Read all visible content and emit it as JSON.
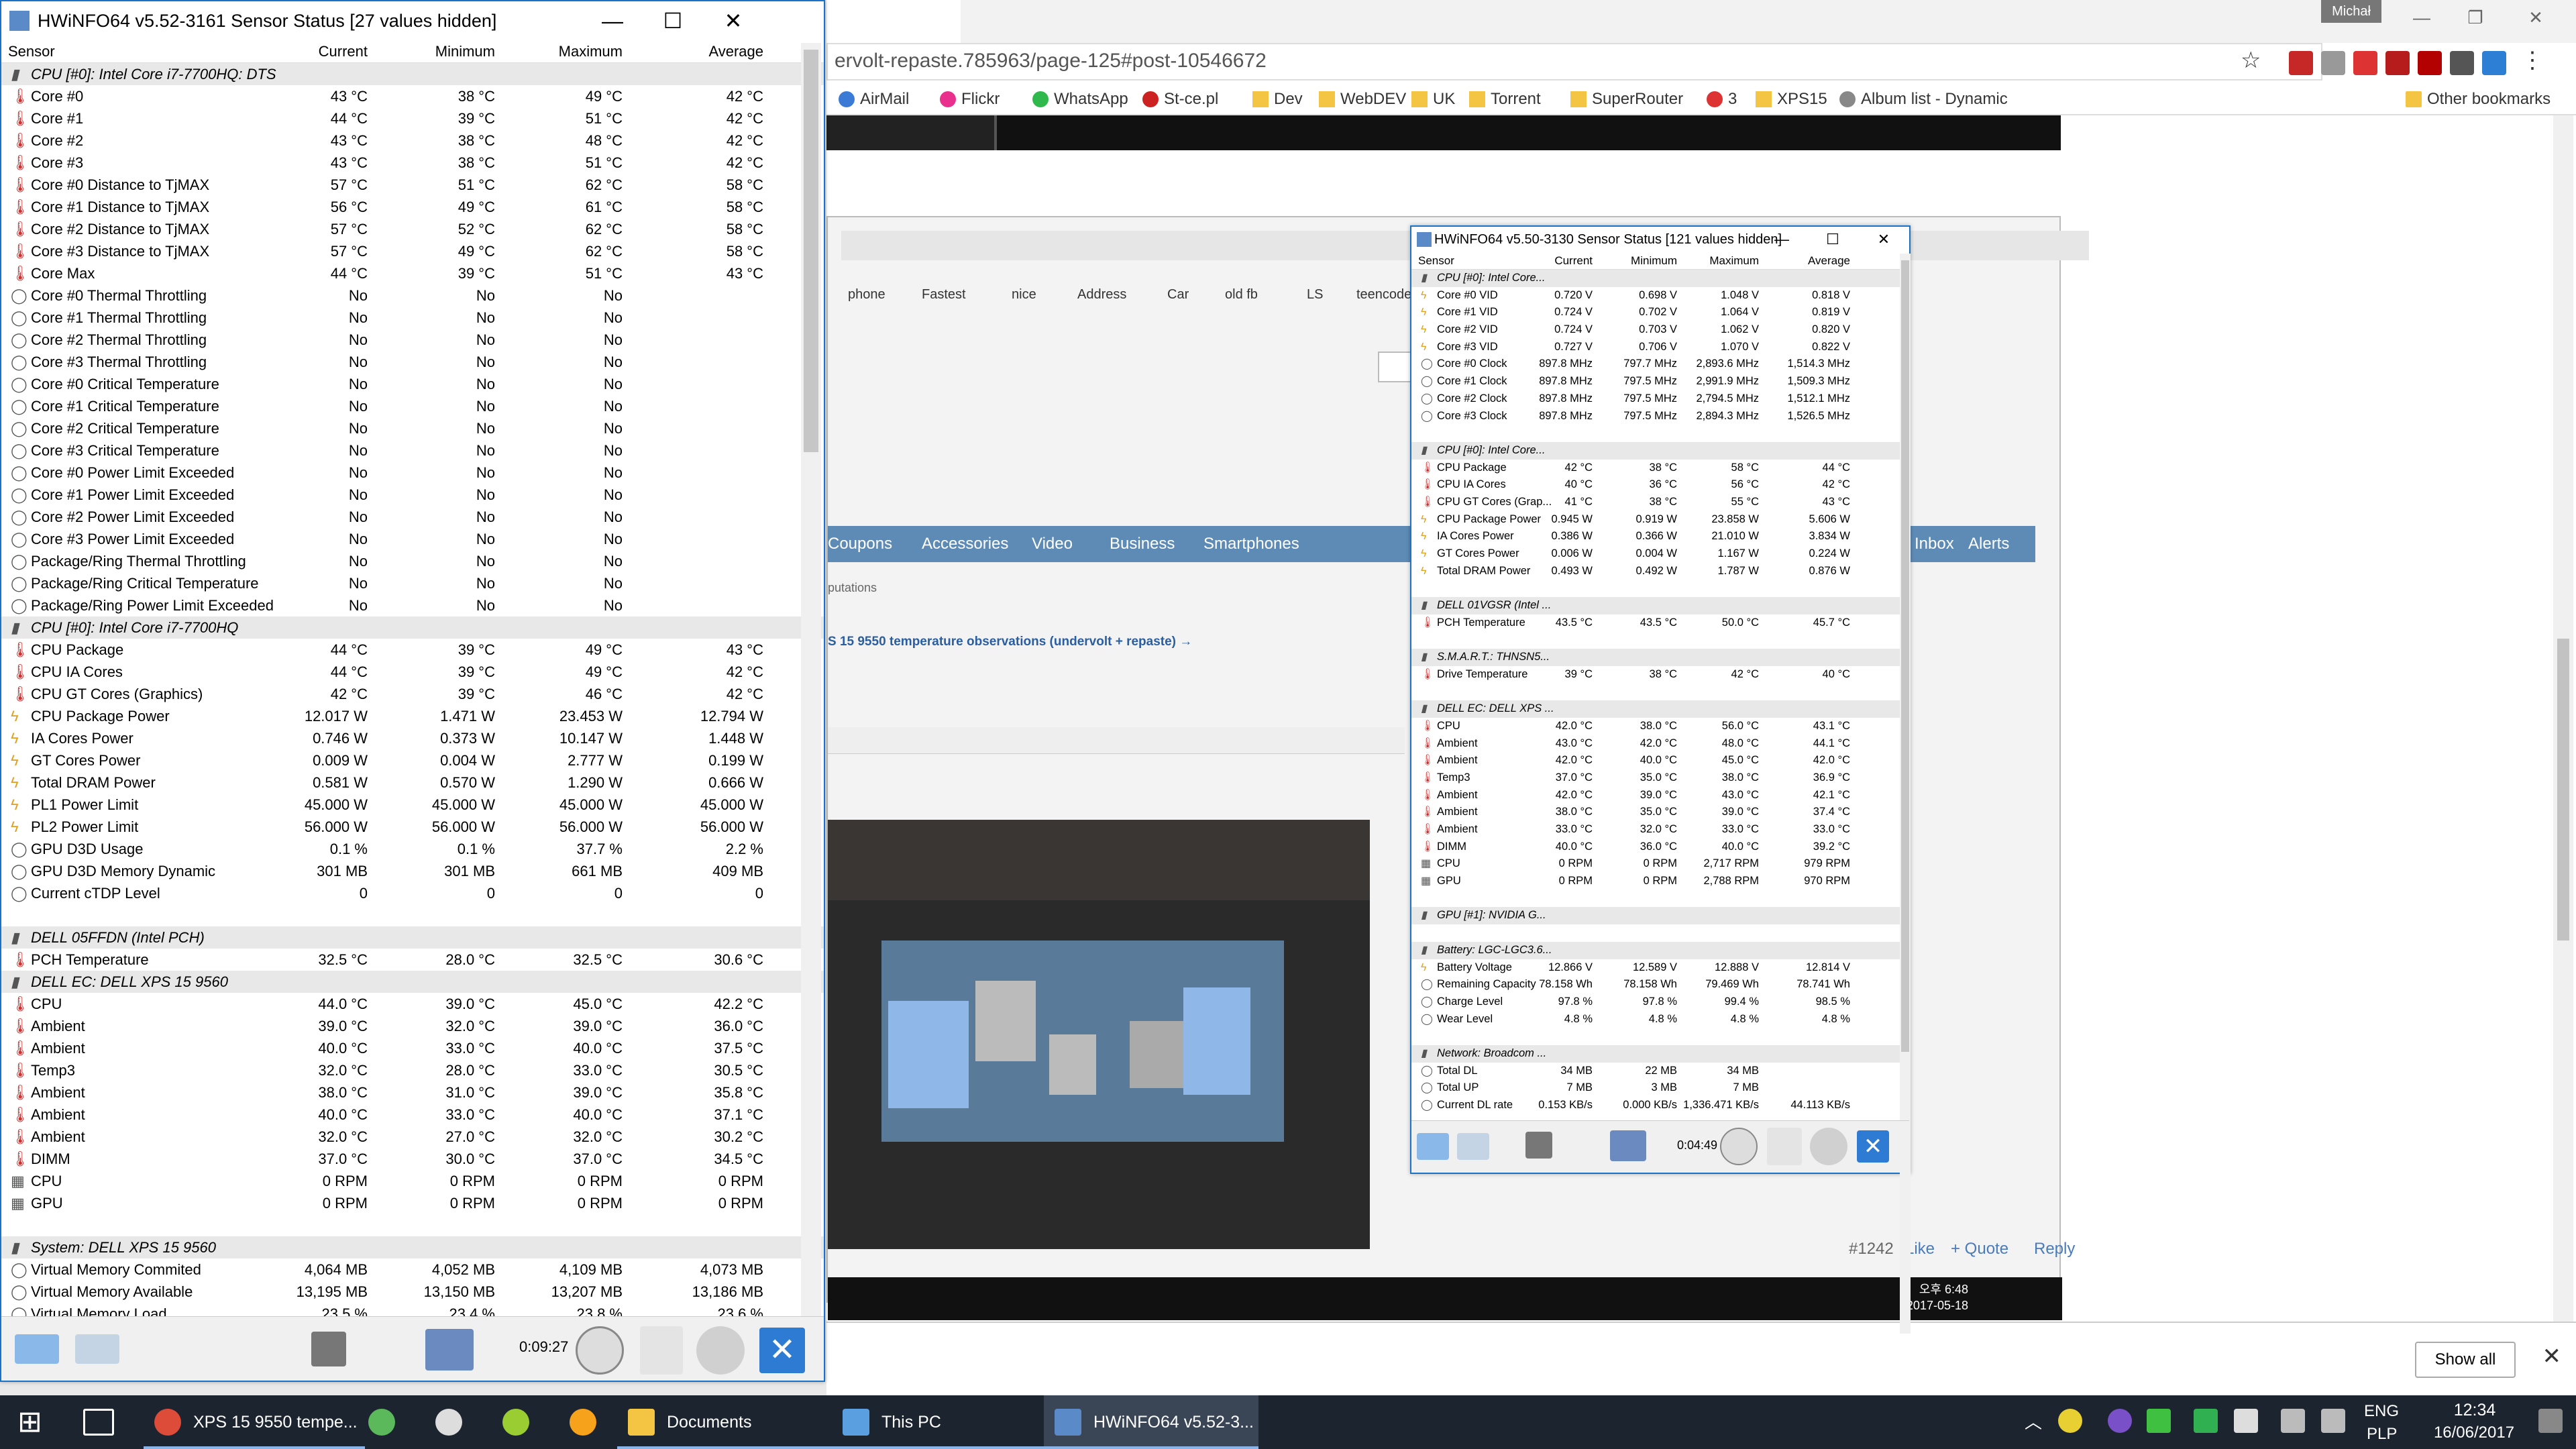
{
  "chrome": {
    "profile": "Michał",
    "url": "ervolt-repaste.785963/page-125#post-10546672",
    "bookmarks": [
      {
        "label": "AirMail",
        "icon": "airmail-icon",
        "color": "#3b7bd6"
      },
      {
        "label": "Flickr",
        "icon": "flickr-icon",
        "color": "#e8308c"
      },
      {
        "label": "WhatsApp",
        "icon": "whatsapp-icon",
        "color": "#2fb84b"
      },
      {
        "label": "St-ce.pl",
        "icon": "site-icon",
        "color": "#cc2222"
      },
      {
        "label": "Dev",
        "icon": "folder-icon",
        "color": "#f4c542"
      },
      {
        "label": "WebDEV",
        "icon": "folder-icon",
        "color": "#f4c542"
      },
      {
        "label": "UK",
        "icon": "folder-icon",
        "color": "#f4c542"
      },
      {
        "label": "Torrent",
        "icon": "folder-icon",
        "color": "#f4c542"
      },
      {
        "label": "SuperRouter",
        "icon": "folder-icon",
        "color": "#f4c542"
      },
      {
        "label": "3",
        "icon": "site-icon",
        "color": "#d33"
      },
      {
        "label": "XPS15",
        "icon": "folder-icon",
        "color": "#f4c542"
      },
      {
        "label": "Album list - Dynamic",
        "icon": "page-icon",
        "color": "#888"
      }
    ],
    "other_bookmarks": "Other bookmarks",
    "show_all": "Show all"
  },
  "forum": {
    "nav": [
      "Coupons",
      "Accessories",
      "Video",
      "Business",
      "Smartphones",
      "Inbox",
      "Alerts"
    ],
    "reputations": "putations",
    "thread": "S 15 9550 temperature observations (undervolt + repaste) →",
    "inner_bookmarks": [
      "phone",
      "Fastest",
      "nice",
      "Address",
      "Car",
      "old fb",
      "LS",
      "teencode"
    ],
    "inner_time": "오후 6:48",
    "inner_date": "2017-05-18",
    "post_no": "#1242",
    "like": "Like",
    "quote": "+ Quote",
    "reply": "Reply"
  },
  "hw1": {
    "title": "HWiNFO64 v5.52-3161 Sensor Status [27 values hidden]",
    "headers": [
      "Sensor",
      "Current",
      "Minimum",
      "Maximum",
      "Average"
    ],
    "timer": "0:09:27",
    "rows": [
      {
        "g": true,
        "n": "CPU [#0]: Intel Core i7-7700HQ: DTS"
      },
      {
        "i": "temp",
        "n": "Core #0",
        "v": [
          "43 °C",
          "38 °C",
          "49 °C",
          "42 °C"
        ]
      },
      {
        "i": "temp",
        "n": "Core #1",
        "v": [
          "44 °C",
          "39 °C",
          "51 °C",
          "42 °C"
        ]
      },
      {
        "i": "temp",
        "n": "Core #2",
        "v": [
          "43 °C",
          "38 °C",
          "48 °C",
          "42 °C"
        ]
      },
      {
        "i": "temp",
        "n": "Core #3",
        "v": [
          "43 °C",
          "38 °C",
          "51 °C",
          "42 °C"
        ]
      },
      {
        "i": "temp",
        "n": "Core #0 Distance to TjMAX",
        "v": [
          "57 °C",
          "51 °C",
          "62 °C",
          "58 °C"
        ]
      },
      {
        "i": "temp",
        "n": "Core #1 Distance to TjMAX",
        "v": [
          "56 °C",
          "49 °C",
          "61 °C",
          "58 °C"
        ]
      },
      {
        "i": "temp",
        "n": "Core #2 Distance to TjMAX",
        "v": [
          "57 °C",
          "52 °C",
          "62 °C",
          "58 °C"
        ]
      },
      {
        "i": "temp",
        "n": "Core #3 Distance to TjMAX",
        "v": [
          "57 °C",
          "49 °C",
          "62 °C",
          "58 °C"
        ]
      },
      {
        "i": "temp",
        "n": "Core Max",
        "v": [
          "44 °C",
          "39 °C",
          "51 °C",
          "43 °C"
        ]
      },
      {
        "i": "circ",
        "n": "Core #0 Thermal Throttling",
        "v": [
          "No",
          "No",
          "No",
          ""
        ]
      },
      {
        "i": "circ",
        "n": "Core #1 Thermal Throttling",
        "v": [
          "No",
          "No",
          "No",
          ""
        ]
      },
      {
        "i": "circ",
        "n": "Core #2 Thermal Throttling",
        "v": [
          "No",
          "No",
          "No",
          ""
        ]
      },
      {
        "i": "circ",
        "n": "Core #3 Thermal Throttling",
        "v": [
          "No",
          "No",
          "No",
          ""
        ]
      },
      {
        "i": "circ",
        "n": "Core #0 Critical Temperature",
        "v": [
          "No",
          "No",
          "No",
          ""
        ]
      },
      {
        "i": "circ",
        "n": "Core #1 Critical Temperature",
        "v": [
          "No",
          "No",
          "No",
          ""
        ]
      },
      {
        "i": "circ",
        "n": "Core #2 Critical Temperature",
        "v": [
          "No",
          "No",
          "No",
          ""
        ]
      },
      {
        "i": "circ",
        "n": "Core #3 Critical Temperature",
        "v": [
          "No",
          "No",
          "No",
          ""
        ]
      },
      {
        "i": "circ",
        "n": "Core #0 Power Limit Exceeded",
        "v": [
          "No",
          "No",
          "No",
          ""
        ]
      },
      {
        "i": "circ",
        "n": "Core #1 Power Limit Exceeded",
        "v": [
          "No",
          "No",
          "No",
          ""
        ]
      },
      {
        "i": "circ",
        "n": "Core #2 Power Limit Exceeded",
        "v": [
          "No",
          "No",
          "No",
          ""
        ]
      },
      {
        "i": "circ",
        "n": "Core #3 Power Limit Exceeded",
        "v": [
          "No",
          "No",
          "No",
          ""
        ]
      },
      {
        "i": "circ",
        "n": "Package/Ring Thermal Throttling",
        "v": [
          "No",
          "No",
          "No",
          ""
        ]
      },
      {
        "i": "circ",
        "n": "Package/Ring Critical Temperature",
        "v": [
          "No",
          "No",
          "No",
          ""
        ]
      },
      {
        "i": "circ",
        "n": "Package/Ring Power Limit Exceeded",
        "v": [
          "No",
          "No",
          "No",
          ""
        ]
      },
      {
        "g": true,
        "n": "CPU [#0]: Intel Core i7-7700HQ"
      },
      {
        "i": "temp",
        "n": "CPU Package",
        "v": [
          "44 °C",
          "39 °C",
          "49 °C",
          "43 °C"
        ]
      },
      {
        "i": "temp",
        "n": "CPU IA Cores",
        "v": [
          "44 °C",
          "39 °C",
          "49 °C",
          "42 °C"
        ]
      },
      {
        "i": "temp",
        "n": "CPU GT Cores (Graphics)",
        "v": [
          "42 °C",
          "39 °C",
          "46 °C",
          "42 °C"
        ]
      },
      {
        "i": "bolt",
        "n": "CPU Package Power",
        "v": [
          "12.017 W",
          "1.471 W",
          "23.453 W",
          "12.794 W"
        ]
      },
      {
        "i": "bolt",
        "n": "IA Cores Power",
        "v": [
          "0.746 W",
          "0.373 W",
          "10.147 W",
          "1.448 W"
        ]
      },
      {
        "i": "bolt",
        "n": "GT Cores Power",
        "v": [
          "0.009 W",
          "0.004 W",
          "2.777 W",
          "0.199 W"
        ]
      },
      {
        "i": "bolt",
        "n": "Total DRAM Power",
        "v": [
          "0.581 W",
          "0.570 W",
          "1.290 W",
          "0.666 W"
        ]
      },
      {
        "i": "bolt",
        "n": "PL1 Power Limit",
        "v": [
          "45.000 W",
          "45.000 W",
          "45.000 W",
          "45.000 W"
        ]
      },
      {
        "i": "bolt",
        "n": "PL2 Power Limit",
        "v": [
          "56.000 W",
          "56.000 W",
          "56.000 W",
          "56.000 W"
        ]
      },
      {
        "i": "circ",
        "n": "GPU D3D Usage",
        "v": [
          "0.1 %",
          "0.1 %",
          "37.7 %",
          "2.2 %"
        ]
      },
      {
        "i": "circ",
        "n": "GPU D3D Memory Dynamic",
        "v": [
          "301 MB",
          "301 MB",
          "661 MB",
          "409 MB"
        ]
      },
      {
        "i": "circ",
        "n": "Current cTDP Level",
        "v": [
          "0",
          "0",
          "0",
          "0"
        ]
      },
      {
        "blank": true,
        "n": ""
      },
      {
        "g": true,
        "n": "DELL 05FFDN (Intel PCH)"
      },
      {
        "i": "temp",
        "n": "PCH Temperature",
        "v": [
          "32.5 °C",
          "28.0 °C",
          "32.5 °C",
          "30.6 °C"
        ]
      },
      {
        "g": true,
        "n": "DELL EC: DELL XPS 15 9560"
      },
      {
        "i": "temp",
        "n": "CPU",
        "v": [
          "44.0 °C",
          "39.0 °C",
          "45.0 °C",
          "42.2 °C"
        ]
      },
      {
        "i": "temp",
        "n": "Ambient",
        "v": [
          "39.0 °C",
          "32.0 °C",
          "39.0 °C",
          "36.0 °C"
        ]
      },
      {
        "i": "temp",
        "n": "Ambient",
        "v": [
          "40.0 °C",
          "33.0 °C",
          "40.0 °C",
          "37.5 °C"
        ]
      },
      {
        "i": "temp",
        "n": "Temp3",
        "v": [
          "32.0 °C",
          "28.0 °C",
          "33.0 °C",
          "30.5 °C"
        ]
      },
      {
        "i": "temp",
        "n": "Ambient",
        "v": [
          "38.0 °C",
          "31.0 °C",
          "39.0 °C",
          "35.8 °C"
        ]
      },
      {
        "i": "temp",
        "n": "Ambient",
        "v": [
          "40.0 °C",
          "33.0 °C",
          "40.0 °C",
          "37.1 °C"
        ]
      },
      {
        "i": "temp",
        "n": "Ambient",
        "v": [
          "32.0 °C",
          "27.0 °C",
          "32.0 °C",
          "30.2 °C"
        ]
      },
      {
        "i": "temp",
        "n": "DIMM",
        "v": [
          "37.0 °C",
          "30.0 °C",
          "37.0 °C",
          "34.5 °C"
        ]
      },
      {
        "i": "fan",
        "n": "CPU",
        "v": [
          "0 RPM",
          "0 RPM",
          "0 RPM",
          "0 RPM"
        ]
      },
      {
        "i": "fan",
        "n": "GPU",
        "v": [
          "0 RPM",
          "0 RPM",
          "0 RPM",
          "0 RPM"
        ]
      },
      {
        "blank": true,
        "n": ""
      },
      {
        "g": true,
        "n": "System: DELL XPS 15 9560"
      },
      {
        "i": "circ",
        "n": "Virtual Memory Commited",
        "v": [
          "4,064 MB",
          "4,052 MB",
          "4,109 MB",
          "4,073 MB"
        ]
      },
      {
        "i": "circ",
        "n": "Virtual Memory Available",
        "v": [
          "13,195 MB",
          "13,150 MB",
          "13,207 MB",
          "13,186 MB"
        ]
      },
      {
        "i": "circ",
        "n": "Virtual Memory Load",
        "v": [
          "23.5 %",
          "23.4 %",
          "23.8 %",
          "23.6 %"
        ]
      }
    ]
  },
  "hw2": {
    "title": "HWiNFO64 v5.50-3130 Sensor Status [121 values hidden]",
    "headers": [
      "Sensor",
      "Current",
      "Minimum",
      "Maximum",
      "Average"
    ],
    "timer": "0:04:49",
    "rows": [
      {
        "g": true,
        "n": "CPU [#0]: Intel Core..."
      },
      {
        "i": "bolt",
        "n": "Core #0 VID",
        "v": [
          "0.720 V",
          "0.698 V",
          "1.048 V",
          "0.818 V"
        ]
      },
      {
        "i": "bolt",
        "n": "Core #1 VID",
        "v": [
          "0.724 V",
          "0.702 V",
          "1.064 V",
          "0.819 V"
        ]
      },
      {
        "i": "bolt",
        "n": "Core #2 VID",
        "v": [
          "0.724 V",
          "0.703 V",
          "1.062 V",
          "0.820 V"
        ]
      },
      {
        "i": "bolt",
        "n": "Core #3 VID",
        "v": [
          "0.727 V",
          "0.706 V",
          "1.070 V",
          "0.822 V"
        ]
      },
      {
        "i": "circ",
        "n": "Core #0 Clock",
        "v": [
          "897.8 MHz",
          "797.7 MHz",
          "2,893.6 MHz",
          "1,514.3 MHz"
        ]
      },
      {
        "i": "circ",
        "n": "Core #1 Clock",
        "v": [
          "897.8 MHz",
          "797.5 MHz",
          "2,991.9 MHz",
          "1,509.3 MHz"
        ]
      },
      {
        "i": "circ",
        "n": "Core #2 Clock",
        "v": [
          "897.8 MHz",
          "797.5 MHz",
          "2,794.5 MHz",
          "1,512.1 MHz"
        ]
      },
      {
        "i": "circ",
        "n": "Core #3 Clock",
        "v": [
          "897.8 MHz",
          "797.5 MHz",
          "2,894.3 MHz",
          "1,526.5 MHz"
        ]
      },
      {
        "blank": true,
        "n": ""
      },
      {
        "g": true,
        "n": "CPU [#0]: Intel Core..."
      },
      {
        "i": "temp",
        "n": "CPU Package",
        "v": [
          "42 °C",
          "38 °C",
          "58 °C",
          "44 °C"
        ]
      },
      {
        "i": "temp",
        "n": "CPU IA Cores",
        "v": [
          "40 °C",
          "36 °C",
          "56 °C",
          "42 °C"
        ]
      },
      {
        "i": "temp",
        "n": "CPU GT Cores (Grap...",
        "v": [
          "41 °C",
          "38 °C",
          "55 °C",
          "43 °C"
        ]
      },
      {
        "i": "bolt",
        "n": "CPU Package Power",
        "v": [
          "0.945 W",
          "0.919 W",
          "23.858 W",
          "5.606 W"
        ]
      },
      {
        "i": "bolt",
        "n": "IA Cores Power",
        "v": [
          "0.386 W",
          "0.366 W",
          "21.010 W",
          "3.834 W"
        ]
      },
      {
        "i": "bolt",
        "n": "GT Cores Power",
        "v": [
          "0.006 W",
          "0.004 W",
          "1.167 W",
          "0.224 W"
        ]
      },
      {
        "i": "bolt",
        "n": "Total DRAM Power",
        "v": [
          "0.493 W",
          "0.492 W",
          "1.787 W",
          "0.876 W"
        ]
      },
      {
        "blank": true,
        "n": ""
      },
      {
        "g": true,
        "n": "DELL 01VGSR (Intel ..."
      },
      {
        "i": "temp",
        "n": "PCH Temperature",
        "v": [
          "43.5 °C",
          "43.5 °C",
          "50.0 °C",
          "45.7 °C"
        ]
      },
      {
        "blank": true,
        "n": ""
      },
      {
        "g": true,
        "n": "S.M.A.R.T.: THNSN5..."
      },
      {
        "i": "temp",
        "n": "Drive Temperature",
        "v": [
          "39 °C",
          "38 °C",
          "42 °C",
          "40 °C"
        ]
      },
      {
        "blank": true,
        "n": ""
      },
      {
        "g": true,
        "n": "DELL EC: DELL XPS ..."
      },
      {
        "i": "temp",
        "n": "CPU",
        "v": [
          "42.0 °C",
          "38.0 °C",
          "56.0 °C",
          "43.1 °C"
        ]
      },
      {
        "i": "temp",
        "n": "Ambient",
        "v": [
          "43.0 °C",
          "42.0 °C",
          "48.0 °C",
          "44.1 °C"
        ]
      },
      {
        "i": "temp",
        "n": "Ambient",
        "v": [
          "42.0 °C",
          "40.0 °C",
          "45.0 °C",
          "42.0 °C"
        ]
      },
      {
        "i": "temp",
        "n": "Temp3",
        "v": [
          "37.0 °C",
          "35.0 °C",
          "38.0 °C",
          "36.9 °C"
        ]
      },
      {
        "i": "temp",
        "n": "Ambient",
        "v": [
          "42.0 °C",
          "39.0 °C",
          "43.0 °C",
          "42.1 °C"
        ]
      },
      {
        "i": "temp",
        "n": "Ambient",
        "v": [
          "38.0 °C",
          "35.0 °C",
          "39.0 °C",
          "37.4 °C"
        ]
      },
      {
        "i": "temp",
        "n": "Ambient",
        "v": [
          "33.0 °C",
          "32.0 °C",
          "33.0 °C",
          "33.0 °C"
        ]
      },
      {
        "i": "temp",
        "n": "DIMM",
        "v": [
          "40.0 °C",
          "36.0 °C",
          "40.0 °C",
          "39.2 °C"
        ]
      },
      {
        "i": "fan",
        "n": "CPU",
        "v": [
          "0 RPM",
          "0 RPM",
          "2,717 RPM",
          "979 RPM"
        ]
      },
      {
        "i": "fan",
        "n": "GPU",
        "v": [
          "0 RPM",
          "0 RPM",
          "2,788 RPM",
          "970 RPM"
        ]
      },
      {
        "blank": true,
        "n": ""
      },
      {
        "g": true,
        "n": "GPU [#1]: NVIDIA G..."
      },
      {
        "blank": true,
        "n": ""
      },
      {
        "g": true,
        "n": "Battery: LGC-LGC3.6..."
      },
      {
        "i": "bolt",
        "n": "Battery Voltage",
        "v": [
          "12.866 V",
          "12.589 V",
          "12.888 V",
          "12.814 V"
        ]
      },
      {
        "i": "circ",
        "n": "Remaining Capacity",
        "v": [
          "78.158 Wh",
          "78.158 Wh",
          "79.469 Wh",
          "78.741 Wh"
        ]
      },
      {
        "i": "circ",
        "n": "Charge Level",
        "v": [
          "97.8 %",
          "97.8 %",
          "99.4 %",
          "98.5 %"
        ]
      },
      {
        "i": "circ",
        "n": "Wear Level",
        "v": [
          "4.8 %",
          "4.8 %",
          "4.8 %",
          "4.8 %"
        ]
      },
      {
        "blank": true,
        "n": ""
      },
      {
        "g": true,
        "n": "Network: Broadcom ..."
      },
      {
        "i": "circ",
        "n": "Total DL",
        "v": [
          "34 MB",
          "22 MB",
          "34 MB",
          ""
        ]
      },
      {
        "i": "circ",
        "n": "Total UP",
        "v": [
          "7 MB",
          "3 MB",
          "7 MB",
          ""
        ]
      },
      {
        "i": "circ",
        "n": "Current DL rate",
        "v": [
          "0.153 KB/s",
          "0.000 KB/s",
          "1,336.471 KB/s",
          "44.113 KB/s"
        ]
      }
    ]
  },
  "taskbar": {
    "apps": [
      {
        "label": "XPS 15 9550 tempe...",
        "icon": "chrome-icon",
        "color": "#dd4b39"
      },
      {
        "label": "",
        "icon": "app-green-icon",
        "color": "#5bb85b"
      },
      {
        "label": "",
        "icon": "app-fox-icon",
        "color": "#dddddd"
      },
      {
        "label": "",
        "icon": "app-lime-icon",
        "color": "#9acd32"
      },
      {
        "label": "",
        "icon": "app-orange-icon",
        "color": "#f7a21b"
      },
      {
        "label": "Documents",
        "icon": "folder-icon",
        "color": "#f4c542"
      },
      {
        "label": "This PC",
        "icon": "pc-icon",
        "color": "#5aa0e0"
      },
      {
        "label": "HWiNFO64 v5.52-3...",
        "icon": "hwinfo-icon",
        "color": "#5a8ac8"
      }
    ],
    "lang": "ENG",
    "layout": "PLP",
    "time": "12:34",
    "date": "16/06/2017"
  }
}
